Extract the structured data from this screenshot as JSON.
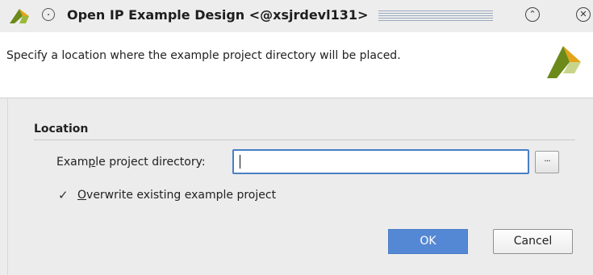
{
  "window": {
    "title": "Open IP Example Design <@xsjrdevl131>",
    "icons": {
      "app": "xilinx-logo-icon",
      "menu": "window-menu-icon",
      "collapse": "chevron-up-icon",
      "close": "close-icon"
    }
  },
  "banner": {
    "description": "Specify a location where the example project directory will be placed.",
    "logo": "xilinx-logo-icon"
  },
  "location_section": {
    "title": "Location",
    "directory_label_pre": "Exam",
    "directory_label_mnemonic": "p",
    "directory_label_post": "le project directory:",
    "directory_value": "",
    "browse_label": "···",
    "overwrite_checked": true,
    "overwrite_check_glyph": "✓",
    "overwrite_mnemonic": "O",
    "overwrite_label_rest": "verwrite existing example project"
  },
  "buttons": {
    "ok": "OK",
    "cancel": "Cancel"
  },
  "colors": {
    "ok_button": "#5588d4",
    "input_focus_border": "#4a7fc6",
    "logo_green": "#6b8a1a",
    "logo_yellow": "#e3a417"
  }
}
